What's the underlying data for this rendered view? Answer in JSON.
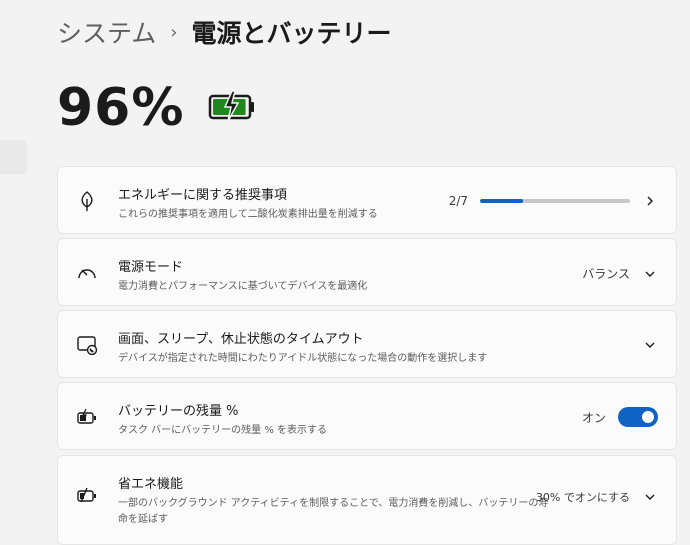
{
  "breadcrumb": {
    "parent": "システム",
    "separator": "›",
    "current": "電源とバッテリー"
  },
  "battery": {
    "percent": "96%",
    "level": 0.96,
    "charging": true,
    "color": "#1e8a1e"
  },
  "cards": {
    "energy": {
      "title": "エネルギーに関する推奨事項",
      "description": "これらの推奨事項を適用して二酸化炭素排出量を削減する",
      "progress_text": "2/7",
      "progress_value": 2,
      "progress_max": 7,
      "icon": "leaf-icon"
    },
    "power_mode": {
      "title": "電源モード",
      "description": "電力消費とパフォーマンスに基づいてデバイスを最適化",
      "value": "バランス",
      "icon": "gauge-icon"
    },
    "screen_sleep": {
      "title": "画面、スリープ、休止状態のタイムアウト",
      "description": "デバイスが指定された時間にわたりアイドル状態になった場合の動作を選択します",
      "icon": "screen-sleep-icon"
    },
    "battery_percentage": {
      "title": "バッテリーの残量 %",
      "description": "タスク バーにバッテリーの残量 % を表示する",
      "toggle_label": "オン",
      "toggle_on": true,
      "icon": "battery-icon"
    },
    "battery_saver": {
      "title": "省エネ機能",
      "description_line1": "一部のバックグラウンド アクティビティを制限することで、電力消費を削減し、バッテリーの寿",
      "description_line2": "命を延ばす",
      "value": "30% でオンにする",
      "icon": "battery-saver-icon"
    }
  },
  "colors": {
    "accent": "#0f63c4",
    "background": "#f3f3f3",
    "card": "#fbfbfb"
  }
}
